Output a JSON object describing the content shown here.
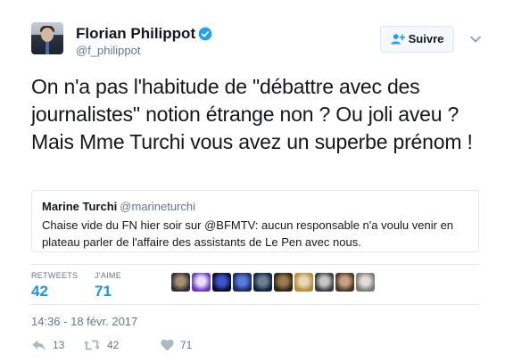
{
  "author": {
    "display_name": "Florian Philippot",
    "handle": "@f_philippot",
    "verified_icon": "verified-badge-icon"
  },
  "follow_button": {
    "label": "Suivre",
    "icon": "add-user-icon"
  },
  "tweet": {
    "text": "On n'a pas l'habitude de \"débattre avec des journalistes\" notion étrange non ? Ou joli aveu ? Mais Mme Turchi vous avez un superbe prénom !"
  },
  "quoted_tweet": {
    "display_name": "Marine Turchi",
    "handle": "@marineturchi",
    "text": "Chaise vide du FN hier soir sur @BFMTV: aucun responsable n'a voulu venir en plateau parler de l'affaire des assistants de Le Pen avec nous."
  },
  "stats": {
    "retweets_label": "RETWEETS",
    "retweets_value": "42",
    "likes_label": "J'AIME",
    "likes_value": "71"
  },
  "likers": [
    {
      "name": "liker-avatar-1",
      "colors": [
        "#2b2f3a",
        "#a78f6b"
      ]
    },
    {
      "name": "liker-avatar-2",
      "colors": [
        "#6a36c8",
        "#e9e1ff"
      ]
    },
    {
      "name": "liker-avatar-3",
      "colors": [
        "#0a0d2a",
        "#3b55d1"
      ]
    },
    {
      "name": "liker-avatar-4",
      "colors": [
        "#1c2a66",
        "#5a78e0"
      ]
    },
    {
      "name": "liker-avatar-5",
      "colors": [
        "#0b2540",
        "#6b7f93"
      ]
    },
    {
      "name": "liker-avatar-6",
      "colors": [
        "#2e2418",
        "#9b7a4b"
      ]
    },
    {
      "name": "liker-avatar-7",
      "colors": [
        "#b88a3a",
        "#e7d9b7"
      ]
    },
    {
      "name": "liker-avatar-8",
      "colors": [
        "#3a3d44",
        "#c8c6c2"
      ]
    },
    {
      "name": "liker-avatar-9",
      "colors": [
        "#4a3526",
        "#c9a283"
      ]
    },
    {
      "name": "liker-avatar-10",
      "colors": [
        "#7a7a78",
        "#e2ddd6"
      ]
    }
  ],
  "timestamp": "14:36 - 18 févr. 2017",
  "actions": {
    "reply_count": "13",
    "retweet_count": "42",
    "like_count": "71"
  },
  "colors": {
    "link": "#1b95e0",
    "muted": "#657786",
    "border": "#e1e8ed"
  }
}
